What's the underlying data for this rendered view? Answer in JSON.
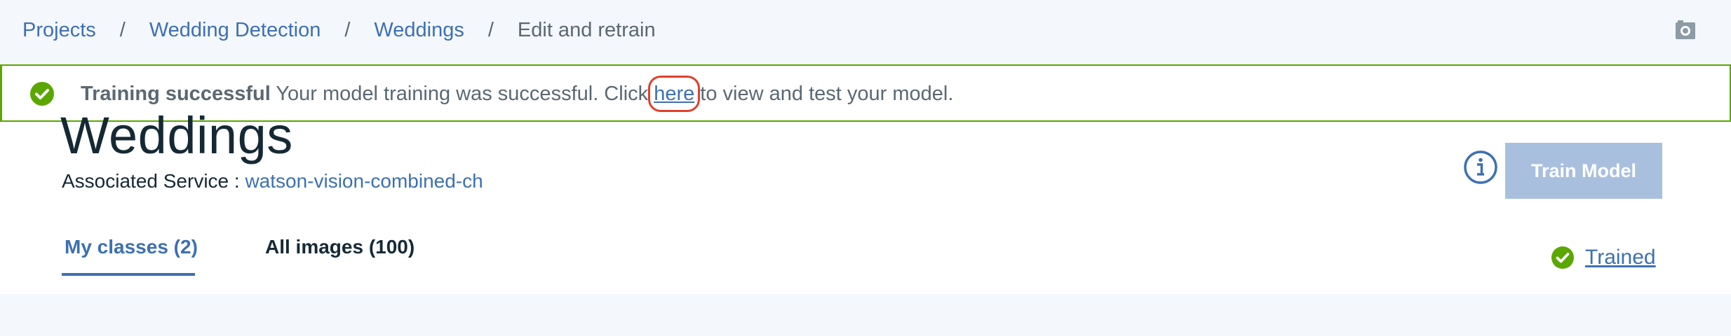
{
  "breadcrumb": {
    "items": [
      "Projects",
      "Wedding Detection",
      "Weddings"
    ],
    "separator": "/",
    "current": "Edit and retrain"
  },
  "notification": {
    "icon": "checkmark-circle-icon",
    "title": "Training successful",
    "message_before": "Your model training was successful. Click ",
    "link_text": "here",
    "message_after": " to view and test your model.",
    "status_color": "#5aa700"
  },
  "page": {
    "title": "Weddings",
    "associated_label": "Associated Service : ",
    "associated_service": "watson-vision-combined-ch"
  },
  "actions": {
    "info_icon": "info-icon",
    "train_button": "Train Model"
  },
  "tabs": [
    {
      "label": "My classes (2)",
      "active": true
    },
    {
      "label": "All images (100)",
      "active": false
    }
  ],
  "status": {
    "icon": "checkmark-circle-icon",
    "label": "Trained"
  },
  "colors": {
    "accent": "#3d70b2",
    "success": "#5aa700",
    "button_disabled": "#a9bfde",
    "highlight": "#e0402b"
  }
}
